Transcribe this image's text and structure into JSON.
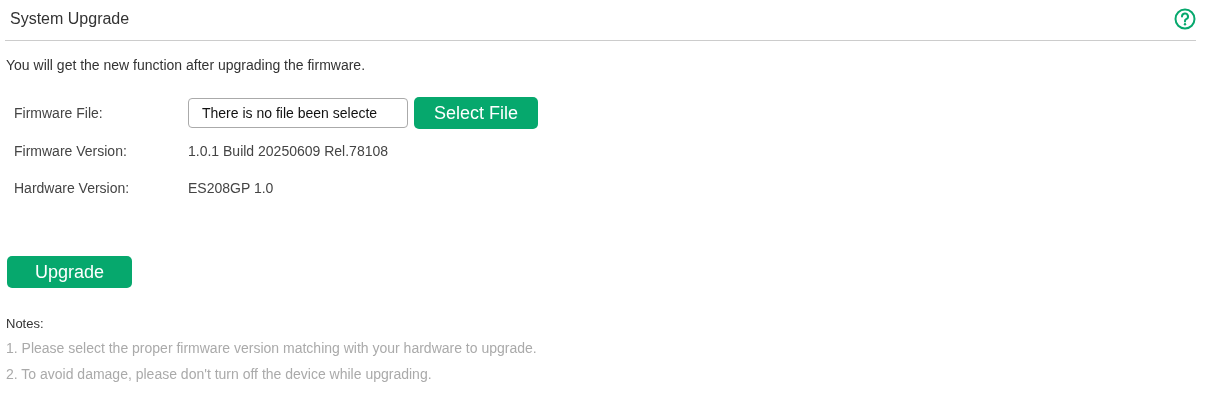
{
  "page": {
    "title": "System Upgrade",
    "intro": "You will get the new function after upgrading the firmware."
  },
  "form": {
    "rows": [
      {
        "kind": "file",
        "label": "Firmware File:",
        "value": "There is no file been selecte",
        "button": "Select File"
      },
      {
        "kind": "text",
        "label": "Firmware Version:",
        "value": "1.0.1 Build 20250609 Rel.78108"
      },
      {
        "kind": "text",
        "label": "Hardware Version:",
        "value": "ES208GP 1.0"
      }
    ]
  },
  "upgrade_button": "Upgrade",
  "notes": {
    "heading": "Notes:",
    "items": [
      "1. Please select the proper firmware version matching with your hardware to upgrade.",
      "2. To avoid damage, please don't turn off the device while upgrading."
    ]
  }
}
